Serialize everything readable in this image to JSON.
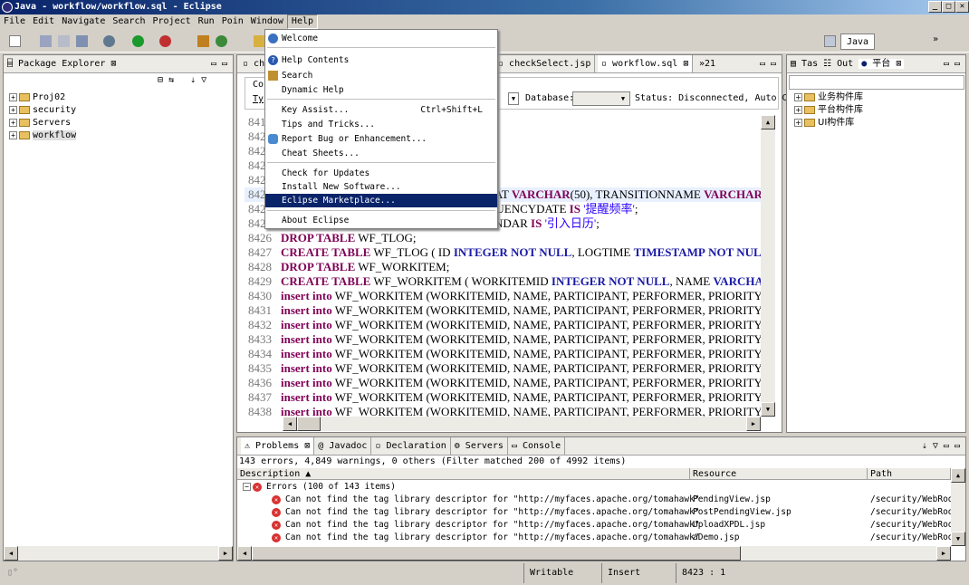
{
  "window": {
    "title": "Java - workflow/workflow.sql - Eclipse"
  },
  "menubar": [
    "File",
    "Edit",
    "Navigate",
    "Search",
    "Project",
    "Run",
    "Poin",
    "Window",
    "Help"
  ],
  "perspective": {
    "label": "Java"
  },
  "package_explorer": {
    "tab_label": "Package Explorer",
    "items": [
      "Proj02",
      "security",
      "Servers",
      "workflow"
    ]
  },
  "editor": {
    "tabs": [
      "ch",
      "checkSelect.jsp",
      "workflow.sql",
      "»21"
    ],
    "connection_fragment": "Co",
    "type_fragment": "Ty",
    "database_label": "Database:",
    "status_text": "Status: Disconnected, Auto Comm",
    "hidden_line_fragments": [
      "841",
      "842",
      "842",
      "842",
      "842",
      "842",
      "842",
      "842"
    ],
    "partial_lines": [
      "EAT VARCHAR(50), TRANSITIONNAME VARCHAR(",
      "QUENCYDATE IS '提醒频率';",
      "ENDAR IS '引入日历';"
    ],
    "lines": [
      {
        "num": "8426",
        "kw": "DROP TABLE",
        "rest": "WF_TLOG;"
      },
      {
        "num": "8427",
        "kw": "CREATE TABLE",
        "rest": "WF_TLOG ( ID INTEGER NOT NULL, LOGTIME TIMESTAMP NOT NULL, TE"
      },
      {
        "num": "8428",
        "kw": "DROP TABLE",
        "rest": "WF_WORKITEM;"
      },
      {
        "num": "8429",
        "kw": "CREATE TABLE",
        "rest": "WF_WORKITEM ( WORKITEMID INTEGER NOT NULL, NAME VARCHAR(64"
      },
      {
        "num": "8430",
        "kw": "insert into",
        "rest": "WF_WORKITEM (WORKITEMID, NAME, PARTICIPANT, PERFORMER, PRIORITY,"
      },
      {
        "num": "8431",
        "kw": "insert into",
        "rest": "WF_WORKITEM (WORKITEMID, NAME, PARTICIPANT, PERFORMER, PRIORITY,"
      },
      {
        "num": "8432",
        "kw": "insert into",
        "rest": "WF_WORKITEM (WORKITEMID, NAME, PARTICIPANT, PERFORMER, PRIORITY,"
      },
      {
        "num": "8433",
        "kw": "insert into",
        "rest": "WF_WORKITEM (WORKITEMID, NAME, PARTICIPANT, PERFORMER, PRIORITY,"
      },
      {
        "num": "8434",
        "kw": "insert into",
        "rest": "WF_WORKITEM (WORKITEMID, NAME, PARTICIPANT, PERFORMER, PRIORITY,"
      },
      {
        "num": "8435",
        "kw": "insert into",
        "rest": "WF_WORKITEM (WORKITEMID, NAME, PARTICIPANT, PERFORMER, PRIORITY,"
      },
      {
        "num": "8436",
        "kw": "insert into",
        "rest": "WF_WORKITEM (WORKITEMID, NAME, PARTICIPANT, PERFORMER, PRIORITY,"
      },
      {
        "num": "8437",
        "kw": "insert into",
        "rest": "WF_WORKITEM (WORKITEMID, NAME, PARTICIPANT, PERFORMER, PRIORITY,"
      },
      {
        "num": "8438",
        "kw": "insert into",
        "rest": "WF_WORKITEM (WORKITEMID, NAME, PARTICIPANT, PERFORMER, PRIORITY,"
      }
    ]
  },
  "help_menu": {
    "items": [
      {
        "label": "Welcome",
        "shortcut": ""
      },
      {
        "label": "Help Contents",
        "shortcut": ""
      },
      {
        "label": "Search",
        "shortcut": ""
      },
      {
        "label": "Dynamic Help",
        "shortcut": ""
      },
      {
        "label": "Key Assist...",
        "shortcut": "Ctrl+Shift+L"
      },
      {
        "label": "Tips and Tricks...",
        "shortcut": ""
      },
      {
        "label": "Report Bug or Enhancement...",
        "shortcut": ""
      },
      {
        "label": "Cheat Sheets...",
        "shortcut": ""
      },
      {
        "label": "Check for Updates",
        "shortcut": ""
      },
      {
        "label": "Install New Software...",
        "shortcut": ""
      },
      {
        "label": "Eclipse Marketplace...",
        "shortcut": ""
      },
      {
        "label": "About Eclipse",
        "shortcut": ""
      }
    ]
  },
  "right_panel": {
    "tabs": [
      "Tas",
      "Out",
      "平台"
    ],
    "items": [
      "业务构件库",
      "平台构件库",
      "UI构件库"
    ]
  },
  "problems": {
    "tabs": [
      "Problems",
      "Javadoc",
      "Declaration",
      "Servers",
      "Console"
    ],
    "summary": "143 errors, 4,849 warnings, 0 others (Filter matched 200 of 4992 items)",
    "columns": [
      "Description",
      "Resource",
      "Path"
    ],
    "group": "Errors (100 of 143 items)",
    "rows": [
      {
        "desc": "Can not find the tag library descriptor for \"http://myfaces.apache.org/tomahawk\"",
        "resource": "PendingView.jsp",
        "path": "/security/WebRoot/"
      },
      {
        "desc": "Can not find the tag library descriptor for \"http://myfaces.apache.org/tomahawk\"",
        "resource": "PostPendingView.jsp",
        "path": "/security/WebRoot/"
      },
      {
        "desc": "Can not find the tag library descriptor for \"http://myfaces.apache.org/tomahawk\"",
        "resource": "UploadXPDL.jsp",
        "path": "/security/WebRoot/"
      },
      {
        "desc": "Can not find the tag library descriptor for \"http://myfaces.apache.org/tomahawk\"",
        "resource": "aDemo.jsp",
        "path": "/security/WebRoot/"
      }
    ]
  },
  "statusbar": {
    "writable": "Writable",
    "insert": "Insert",
    "position": "8423 : 1"
  }
}
